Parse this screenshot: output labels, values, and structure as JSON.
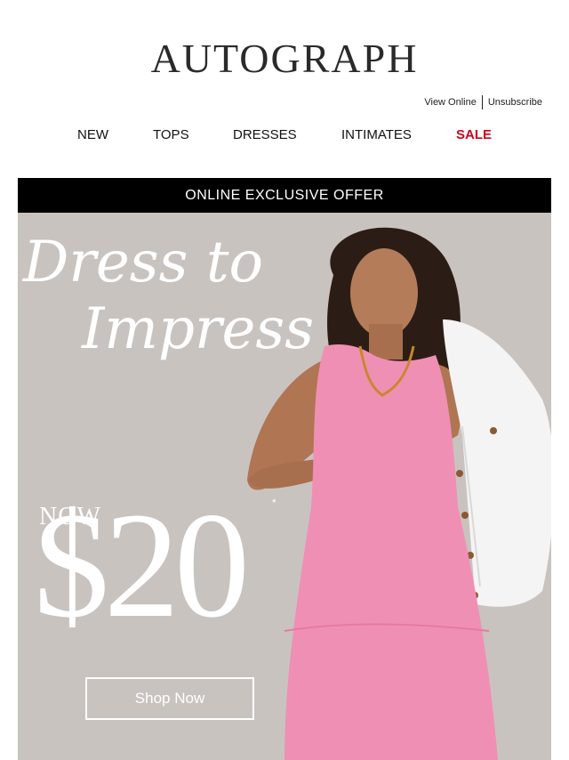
{
  "header": {
    "logo_text": "AUTOGRAPH",
    "view_online": "View Online",
    "unsubscribe": "Unsubscribe"
  },
  "nav": {
    "items": [
      {
        "label": "NEW"
      },
      {
        "label": "TOPS"
      },
      {
        "label": "DRESSES"
      },
      {
        "label": "INTIMATES"
      },
      {
        "label": "SALE",
        "highlight_color": "#d0021b"
      }
    ]
  },
  "hero": {
    "banner_text": "ONLINE EXCLUSIVE OFFER",
    "headline_line1": "Dress to",
    "headline_line2": "Impress",
    "now_label": "NOW",
    "price": "$20",
    "asterisk": "*",
    "cta_label": "Shop Now",
    "dress_color": "#f08fb4",
    "jacket_color": "#f7f7f7"
  }
}
